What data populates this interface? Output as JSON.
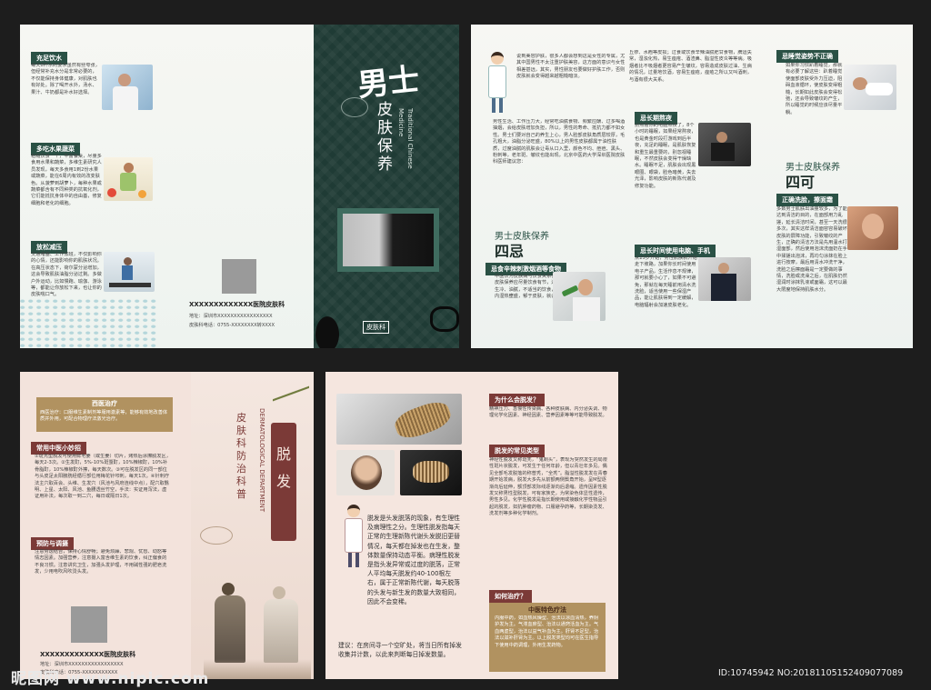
{
  "tl_left": {
    "s1_title": "充足饮水",
    "s1_text": "每天8杯水的要求虽然有些夸张，但经常补充水分是非常必要的，不仅能保持身体健康，对肌肤也有好处。除了喝开水外，汤水、果汁、牛奶都是补水好选择。",
    "s2_title": "多吃水果蔬菜",
    "s2_text": "粗糙饮食一个，丰富餐桌，尽量多食用水果和蔬菜，多维生素研究人员发现，每天多食用1到2份水果或蔬菜，能在6周内有效的改变肤色。从菠萝到胡萝卜，每种水果或蔬菜都含有不同种类的抗氧化剂，它们能抵抗身体中的自由基，修复细胞和老化的细胞。",
    "s3_title": "放松减压",
    "s3_text": "交通堵塞、工作加班，不仅影响你的心情，还能影响你的肌肤状况。在高压状态下，荷尔蒙分泌增加，这会导致肌肤油脂分泌过剩。多做户外运动，比如慢跑、瑜伽、游泳等，都能让你放松下来，也让你的皮肤喘口气。",
    "hospital": "XXXXXXXXXXXXX医院皮肤科",
    "address": "地址：深圳市XXXXXXXXXXXXXXXXX",
    "phone": "皮肤科电话：0755-XXXXXXXX转XXXX"
  },
  "tl_cover": {
    "title_big": "男士",
    "title_sub": "皮肤保养",
    "title_en_1": "Traditional Chinese",
    "title_en_2": "Medicine",
    "badge": "皮肤科"
  },
  "tr": {
    "intro": "说到美容护肤，很多人都会想到这是女性的专属，尤其中国男性不太注重护肤美容，这方面的意识与女性相差甚远，其实，男性朋友也要做好护肤工作，否则皮肤就会变得越来越粗糙暗淡。",
    "intro2": "男性生活、工作压力大，经常吃油腻食物、频繁应酬、过多喝酒抽烟，会给皮肤增加负担，所以，男性的寿命、抵抗力都不如女性。男士们要对自己的养生上心，男人脸部皮肤角质层较厚，毛孔粗大，油脂分泌旺盛，80%以上的男性皮肤都属于油性肤质，过度油腻的肌肤会让毒从口入里，颜色不均、痘痘、黑头、粉刺等，老年斑、皱纹也能出现，北京中医药大学深圳医院皮肤科医师建议您：",
    "four_no_title_1": "男士皮肤保养",
    "four_no_title_2": "四忌",
    "no1_tag": "忌食辛辣刺激烟酒等食物",
    "no1_text": "中医认为皮肤病与饮食关系密切，男士皮肤保养应尽量饮食有节，过食辛辣、生冷、油腻，不适当的饮食，会导致体内湿热壅盛，郁于皮肤，就会长痤疮。",
    "col2_text": "丘疹、水疱等皮损；过食或饮食辛辣油腻肥甘食物，脾运失常，湿浊化热，易生痤疮、酒渣鼻、脂溢性皮炎等等病。吸烟者比不吸烟者更容易产生皱纹，容易造成皮肤过油、生病的情况，过量地饮酒，容易生痤疮，痤疮之所以又叫酒刺，与酒有很大关系。",
    "no2_tag": "忌长期熬夜",
    "no2_text": "别熬着你的电脑熬夜了，8个小时的睡眠，如果经常熬夜，也是黄金时段打游戏到后半夜，充足的睡眠，是肌肤恢复和重生最重要的，别忽视睡眠，不然皮肤会变得干燥缺水。睡眠不足，肌肤会出现黑眼圈、眼袋，脸色暗黄，失去光泽，影响皮肤的新陈代谢及修复功能。",
    "no3_tag": "忌长时间使用电脑、手机",
    "no3_text": "从25岁开始，男性肌肤就开始走下坡路，加果你长时间使用电子产品，生活作息不规律，那可就要小心了，如果不可避免，那就在每天睡前用清水洗洗脸，适当使用一些保湿产品，能让肌肤得到一定缓解，电脑辐射会加速皮肤老化。",
    "side_tag": "忌睡觉姿势不正确",
    "side_text": "如果你习惯趴着睡觉，那就有必要了解这些：趴着睡觉使面部皮肤受外力压迫，阻碍血液循环，使皮肤变得粗糙，长期如此皮肤会变得松弛，还会导致皱纹的产生，所以睡觉的时候应该尽量平躺。",
    "four_yes_title_1": "男士皮肤保养",
    "four_yes_title_2": "四可",
    "yes1_tag": "正确洗脸，擦面霜",
    "yes1_text": "多数男士肌肤出油量较多，为了能达到清洁的目的，在面部用力乱搓，延长清洁时间，甚至一天洗很多次，其实这样清洁面容容易破坏皮肤的屏障功能，引致皱纹的产生，正确的清洁方法是先用温水打湿面部，然后使用泡沫洗面奶在手中揉搓出泡沫，再均匀涂抹在脸上进行按摩，最后用清水冲洗干净，洗脸之后擦面霜是一定要做的事情，洗脸或洗澡之后，在肌肤仍然湿润时涂抹乳液或面霜，这可以最大限度地保持肌肤水分。"
  },
  "bl": {
    "tcm_tag": "西医治疗",
    "tcm_text": "西医治疗：口服维生素制剂等服用激素等，能够有效地改善体质并外用，可配合物理疗法激光治疗。",
    "method_tag": "常用中医小妙招",
    "method_text": "①斑秃型脱发可使用鲜毛姜（或生姜）切片，烤热后涂擦脱发区，每天2-3次。②生发酊，5%-10%斑蝥酊，10%辣椒酊，10%补骨脂酊，10%辣椒酊外擦，每天数次。③可在脱发区的同一部位与头皮足太阳膀胱经循行部位用梅花针叩刺，每天1次。④针刺疗法主穴取百会、头维、生发穴（风池与风府连线中点），配穴取翳明、上星、太阳、风池、鱼腰透丝竹空，手法：实证用泻法，虚证用补法，每次取一到二穴，每日或隔日1次。",
    "prevent_tag": "预防与调摄",
    "prevent_text": "注意劳逸结合，保持心情舒畅；避免烦躁、悲观、忧愁、动怒等情志因素。加强营养，注意摄入富含维生素的饮食，纠正偏食的不良习惯。注意讲究卫生，加强头发护理，不用碱性强的肥皂洗发，少用电吹风吹烫头发。",
    "hospital": "XXXXXXXXXXXXX医院皮肤科",
    "address": "地址：深圳市XXXXXXXXXXXXXXXXX",
    "phone": "皮肤科电话：0755-XXXXXXXXXXX",
    "cover_vertical_1": "皮肤科防治科普",
    "cover_vertical_en": "DERMATOLOGICAL DEPARTMENT",
    "cover_title": "脱发"
  },
  "br": {
    "intro": "脱发是头发脱落的现象，有生理性及病理性之分。生理性脱发指每天正常的生理新陈代谢头发脱旧更替情况，每天都在掉发也在生发，整体数量保持动态平衡。病理性脱发是指头发异常或过度的脱落，正常人平均每天脱发约40-100根左右，属于正常新陈代谢，每天脱落的头发与新生发的数量大致相同，因此不会变稀。",
    "advice": "建议：在房间寻一个空旷处，将当日所有掉发收集并计数，以此来判断每日掉发数量。",
    "why_tag": "为什么会脱发？",
    "why_text": "精神压力、急慢性传染病、各种皮肤病、内分泌失调、物理化学化因素、神经因素、营养因素等等可能导致脱发。",
    "type_tag": "脱发的常见类型",
    "type_text": "神经性脱发又称斑秃，“鬼剃头”，表现为突然发生的局限性斑片状脱发，可发生于任何年龄，但以青壮年多见。偶见全部毛发脱落的称普秃，“全秃”。脂溢性脱发发在青春期开始发病，脱发大多先从前额两侧鬓角开始，呈M型逐渐向后延伸，额顶部发际线逐渐向后退缩。遗传因素性脱发又称男性型脱发，可有家族史，为常染色体显性遗传，男性多见。化学性脱发是指长期使用或接触化学性物品引起的脱发，如抗肿瘤药物、口服避孕药等，长期染烫发、洗发剂等多种化学制剂。",
    "how_tag": "如何治疗？",
    "tcm_box_title": "中医特色疗法",
    "tcm_box_text": "内服中药，如血热风燥型、治法以凉血清热，养阴护发为主。气滞血瘀型、治法以通窍活血为主。气血两虚型，治法以益气补血为主。肝肾不足型，治法以滋补肝肾为主。以上脱发类型均可在医生指导下使用中药调理，外用生发药物。"
  },
  "watermark": "昵图网 www.nipic.com",
  "footer_id": "ID:10745942 NO:20181105152409077089"
}
